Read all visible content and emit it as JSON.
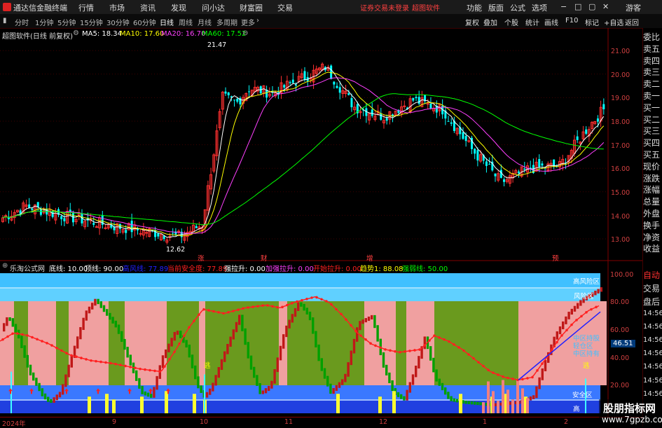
{
  "titlebar": {
    "app_title": "通达信金融终端",
    "menu": [
      "行情",
      "市场",
      "资讯",
      "发现",
      "问小达",
      "财富圈",
      "交易"
    ],
    "notice": "证券交易未登录",
    "brand": "超图软件",
    "right_menu": [
      "功能",
      "版面",
      "公式",
      "选项"
    ],
    "guest": "游客"
  },
  "toolbar": {
    "periods": [
      "分时",
      "1分钟",
      "5分钟",
      "15分钟",
      "30分钟",
      "60分钟",
      "日线",
      "周线",
      "月线",
      "多周期",
      "更多"
    ],
    "active_period": "日线",
    "right_buttons": [
      "复权",
      "叠加",
      "个股",
      "统计",
      "画线",
      "F10",
      "标记",
      "+自选",
      "返回"
    ]
  },
  "main_chart": {
    "title": "超图软件(日线 前复权)",
    "ma": [
      {
        "label": "MA5: 18.34",
        "color": "#ffffff"
      },
      {
        "label": "MA10: 17.60",
        "color": "#ffff00"
      },
      {
        "label": "MA20: 16.70",
        "color": "#ff40ff"
      },
      {
        "label": "MA60: 17.52",
        "color": "#00ff00"
      }
    ],
    "y_ticks": [
      "21.00",
      "20.00",
      "19.00",
      "18.00",
      "17.00",
      "16.00",
      "15.00",
      "14.00",
      "13.00"
    ],
    "high_label": "21.47",
    "low_label": "12.62",
    "event_marks": [
      "涨",
      "财",
      "增",
      "预"
    ]
  },
  "indicator": {
    "title": "乐淘公式网",
    "params": [
      {
        "label": "底线: 10.00",
        "color": "#ffffff"
      },
      {
        "label": "顶线: 90.00",
        "color": "#ffffff"
      },
      {
        "label": "高风线: 77.89",
        "color": "#0000ff"
      },
      {
        "label": "当前安全度: 77.89",
        "color": "#ff2020"
      },
      {
        "label": "强拉升: 0.00",
        "color": "#ffffff"
      },
      {
        "label": "加强拉升: 0.00",
        "color": "#ff40ff"
      },
      {
        "label": "开始拉升: 0.00",
        "color": "#ff2020"
      },
      {
        "label": "趋势1: 88.08",
        "color": "#ffff00"
      },
      {
        "label": "强弱线: 50.00",
        "color": "#00ff00"
      }
    ],
    "y_ticks": [
      "100.00",
      "80.00",
      "60.00",
      "40.00",
      "20.00"
    ],
    "zones": [
      "高风险区",
      "风险区",
      "中区持股",
      "轻仓区",
      "中区持有",
      "安全区",
      "高"
    ],
    "current_value": "46.51",
    "escape_label": "逃"
  },
  "x_axis": {
    "labels": [
      "2024年",
      "9",
      "10",
      "11",
      "12",
      "1",
      "2"
    ]
  },
  "side_panel": {
    "labels": [
      "委比",
      "卖五",
      "卖四",
      "卖三",
      "卖二",
      "卖一",
      "买一",
      "买二",
      "买三",
      "买四",
      "买五",
      "现价",
      "涨跌",
      "涨幅",
      "总量",
      "外盘",
      "换手",
      "净资",
      "收益",
      "自动",
      "交易",
      "盘后",
      "14:56",
      "14:56",
      "14:56",
      "14:56",
      "14:56",
      "14:56",
      "14:56"
    ]
  },
  "watermark": {
    "line1": "股朋指标网",
    "line2": "www.7gpzb.com"
  },
  "colors": {
    "up": "#ff3030",
    "down": "#00ffff",
    "ma5": "#ffffff",
    "ma10": "#ffff00",
    "ma20": "#ff40ff",
    "ma60": "#00ff00",
    "pink_zone": "#f0a0a0",
    "green_zone": "#6a9a1e",
    "blue_zone": "#3a78ff",
    "risk_zone": "#40c0ff"
  }
}
